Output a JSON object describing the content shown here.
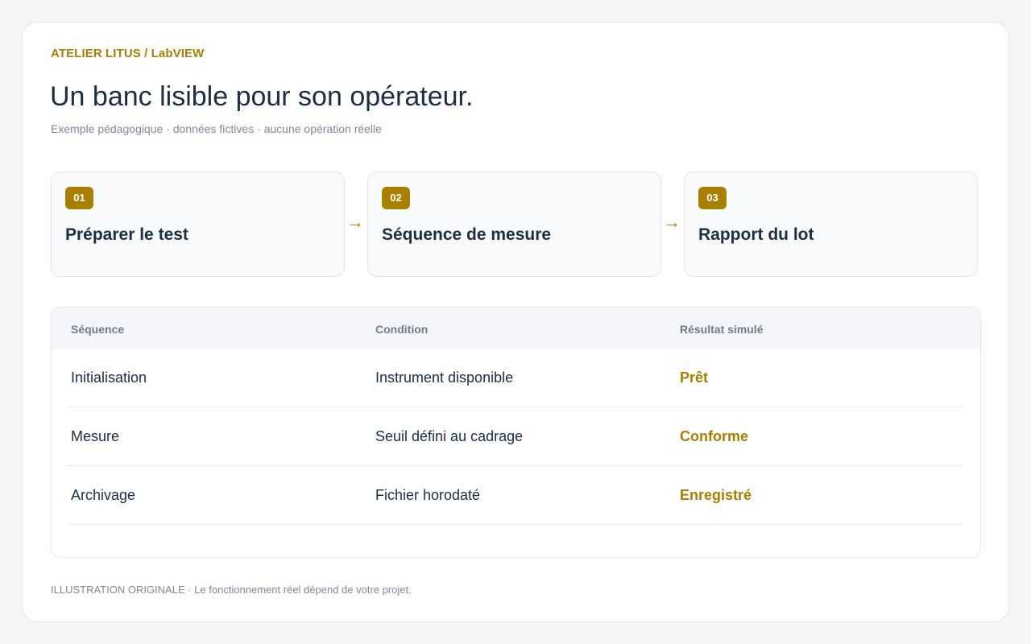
{
  "header": {
    "eyebrow": "ATELIER LITUS / LabVIEW",
    "title": "Un banc lisible pour son opérateur.",
    "subtitle": "Exemple pédagogique · données fictives · aucune opération réelle"
  },
  "steps": [
    {
      "number": "01",
      "title": "Préparer le test"
    },
    {
      "number": "02",
      "title": "Séquence de mesure"
    },
    {
      "number": "03",
      "title": "Rapport du lot"
    }
  ],
  "arrow_glyph": "→",
  "table": {
    "columns": [
      "Séquence",
      "Condition",
      "Résultat simulé"
    ],
    "rows": [
      {
        "sequence": "Initialisation",
        "condition": "Instrument disponible",
        "result": "Prêt"
      },
      {
        "sequence": "Mesure",
        "condition": "Seuil défini au cadrage",
        "result": "Conforme"
      },
      {
        "sequence": "Archivage",
        "condition": "Fichier horodaté",
        "result": "Enregistré"
      }
    ]
  },
  "footer": "ILLUSTRATION ORIGINALE · Le fonctionnement réel dépend de votre projet.",
  "colors": {
    "accent": "#a87f00",
    "text": "#1b2e44",
    "muted": "#7e8a98",
    "background": "#f3f5f7"
  }
}
